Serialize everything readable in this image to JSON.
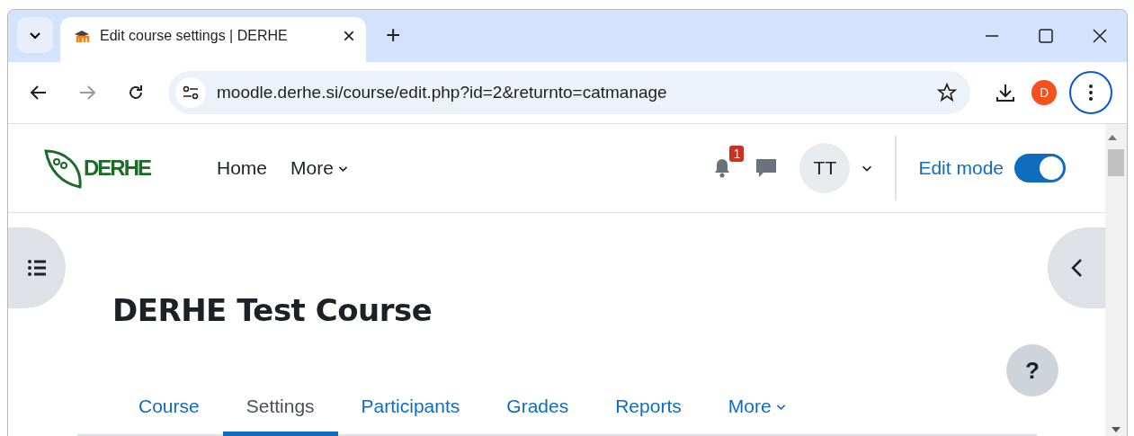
{
  "browser": {
    "tab_title": "Edit course settings | DERHE",
    "tab_close": "×",
    "new_tab": "+",
    "url": "moodle.derhe.si/course/edit.php?id=2&returnto=catmanage",
    "profile": "D"
  },
  "header": {
    "logo": "DERHE",
    "nav": [
      {
        "label": "Home",
        "dropdown": false
      },
      {
        "label": "More",
        "dropdown": true
      }
    ],
    "notification_count": "1",
    "avatar": "TT",
    "edit_mode": {
      "label": "Edit mode",
      "on": true
    }
  },
  "course": {
    "title": "DERHE Test Course"
  },
  "tabs": [
    {
      "label": "Course",
      "selected": false,
      "dropdown": false
    },
    {
      "label": "Settings",
      "selected": true,
      "dropdown": false
    },
    {
      "label": "Participants",
      "selected": false,
      "dropdown": false
    },
    {
      "label": "Grades",
      "selected": false,
      "dropdown": false
    },
    {
      "label": "Reports",
      "selected": false,
      "dropdown": false
    },
    {
      "label": "More",
      "selected": false,
      "dropdown": true
    }
  ],
  "help": "?"
}
